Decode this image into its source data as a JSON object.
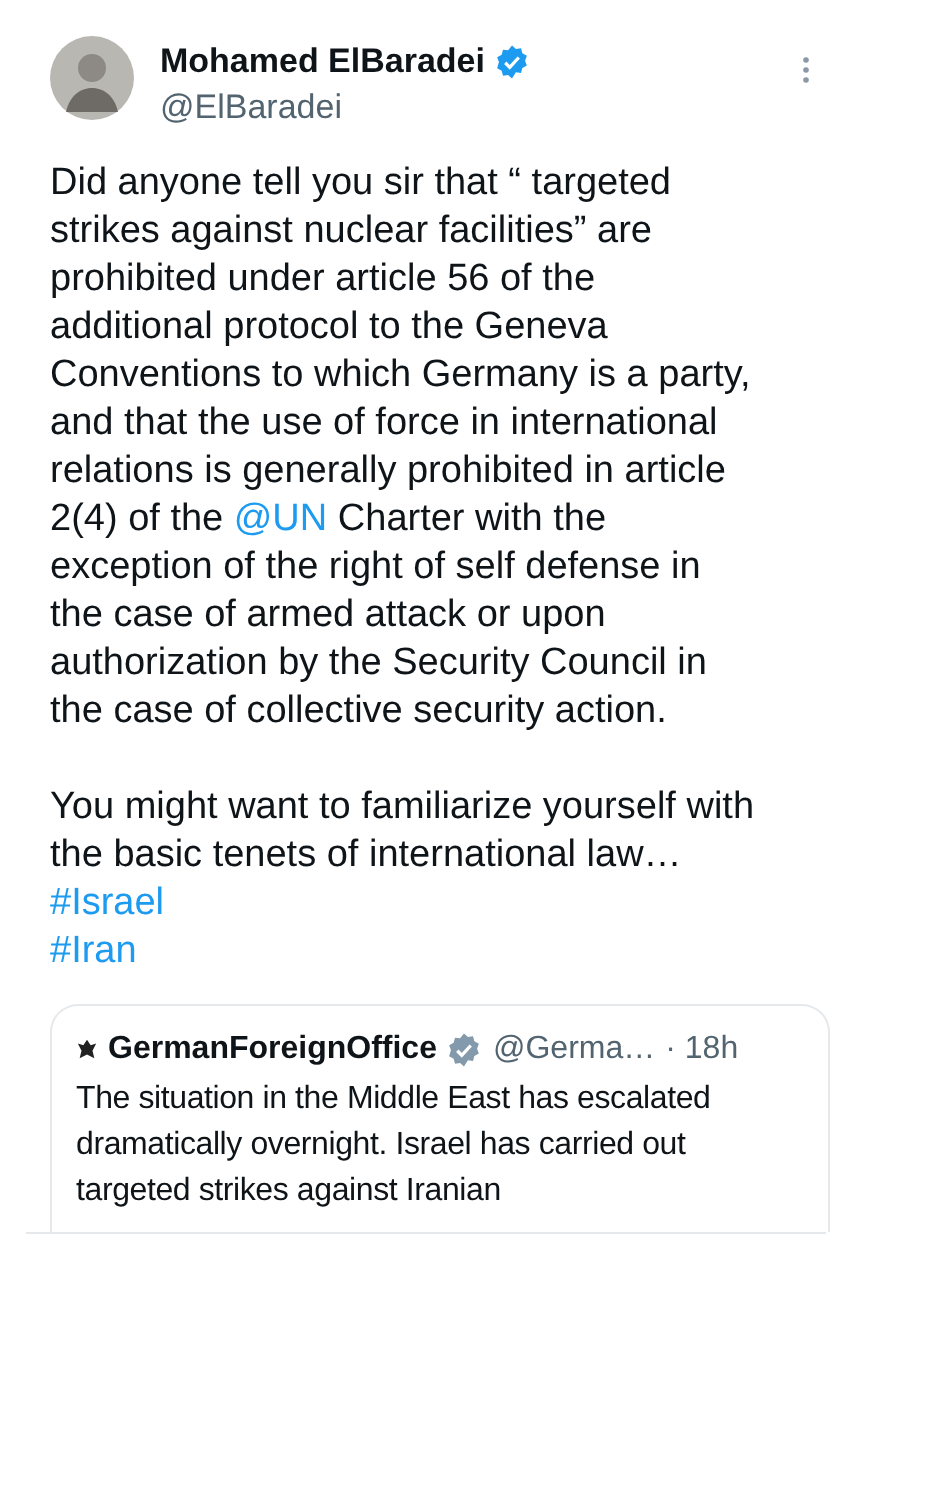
{
  "tweet": {
    "author": {
      "name": "Mohamed ElBaradei",
      "verified": true,
      "handle": "@ElBaradei"
    },
    "paragraphs": [
      {
        "before": "Did anyone tell you sir that “ targeted strikes against nuclear facilities”  are prohibited under article 56 of the additional protocol to the Geneva Conventions to which Germany is a party, and that the use of force in international relations is generally prohibited in article 2(4) of the",
        "mention": "@UN",
        "after": "Charter with the exception of the right of self defense in the case of armed attack or upon authorization by the Security Council in the case of collective security action."
      },
      {
        "before": "You might want to familiarize yourself with the basic tenets of international law…"
      }
    ],
    "hashtags": [
      "#Israel",
      "#Iran"
    ],
    "quote": {
      "name": "GermanForeignOffice",
      "verified": true,
      "handle": "@Germa…",
      "time": "· 18h",
      "text": "The situation in the Middle East has escalated dramatically overnight. Israel has carried out targeted strikes against Iranian"
    }
  }
}
